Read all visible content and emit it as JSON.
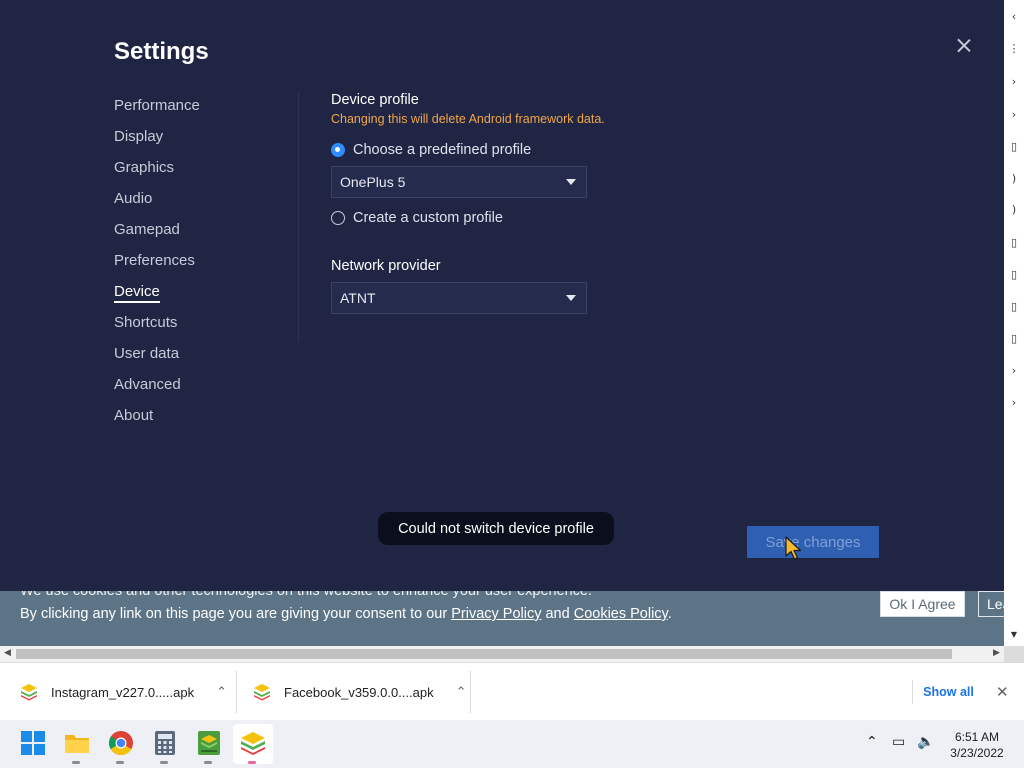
{
  "settings": {
    "title": "Settings",
    "nav": [
      {
        "label": "Performance"
      },
      {
        "label": "Display"
      },
      {
        "label": "Graphics"
      },
      {
        "label": "Audio"
      },
      {
        "label": "Gamepad"
      },
      {
        "label": "Preferences"
      },
      {
        "label": "Device",
        "active": true
      },
      {
        "label": "Shortcuts"
      },
      {
        "label": "User data"
      },
      {
        "label": "Advanced"
      },
      {
        "label": "About"
      }
    ],
    "device_profile": {
      "title": "Device profile",
      "warning": "Changing this will delete Android framework data.",
      "option_predefined": "Choose a predefined profile",
      "option_custom": "Create a custom profile",
      "selected_option": "predefined",
      "profile_value": "OnePlus 5"
    },
    "network": {
      "title": "Network provider",
      "value": "ATNT"
    },
    "toast": "Could not switch device profile",
    "save_label": "Save changes"
  },
  "cookie_banner": {
    "line1": "We use cookies and other technologies on this website to enhance your user experience.",
    "line2_prefix": "By clicking any link on this page you are giving your consent to our ",
    "privacy_link": "Privacy Policy",
    "and": " and ",
    "cookies_link": "Cookies Policy",
    "period": ".",
    "ok_label": "Ok I Agree",
    "learn_label": "Lea"
  },
  "downloads": {
    "items": [
      {
        "name": "Instagram_v227.0.....apk",
        "icon": "bluestacks-icon"
      },
      {
        "name": "Facebook_v359.0.0....apk",
        "icon": "bluestacks-icon"
      }
    ],
    "show_all": "Show all"
  },
  "taskbar": {
    "apps": [
      "windows-start-icon",
      "file-explorer-icon",
      "chrome-icon",
      "calculator-icon",
      "bluestacks-multi-icon",
      "bluestacks-icon"
    ],
    "time": "6:51 AM",
    "date": "3/23/2022"
  },
  "colors": {
    "dialog_bg": "#1f2543",
    "accent": "#2d8cff",
    "warning": "#f0a64a",
    "save_button": "#2f5fb0",
    "cookie_bg": "#5c7485"
  }
}
